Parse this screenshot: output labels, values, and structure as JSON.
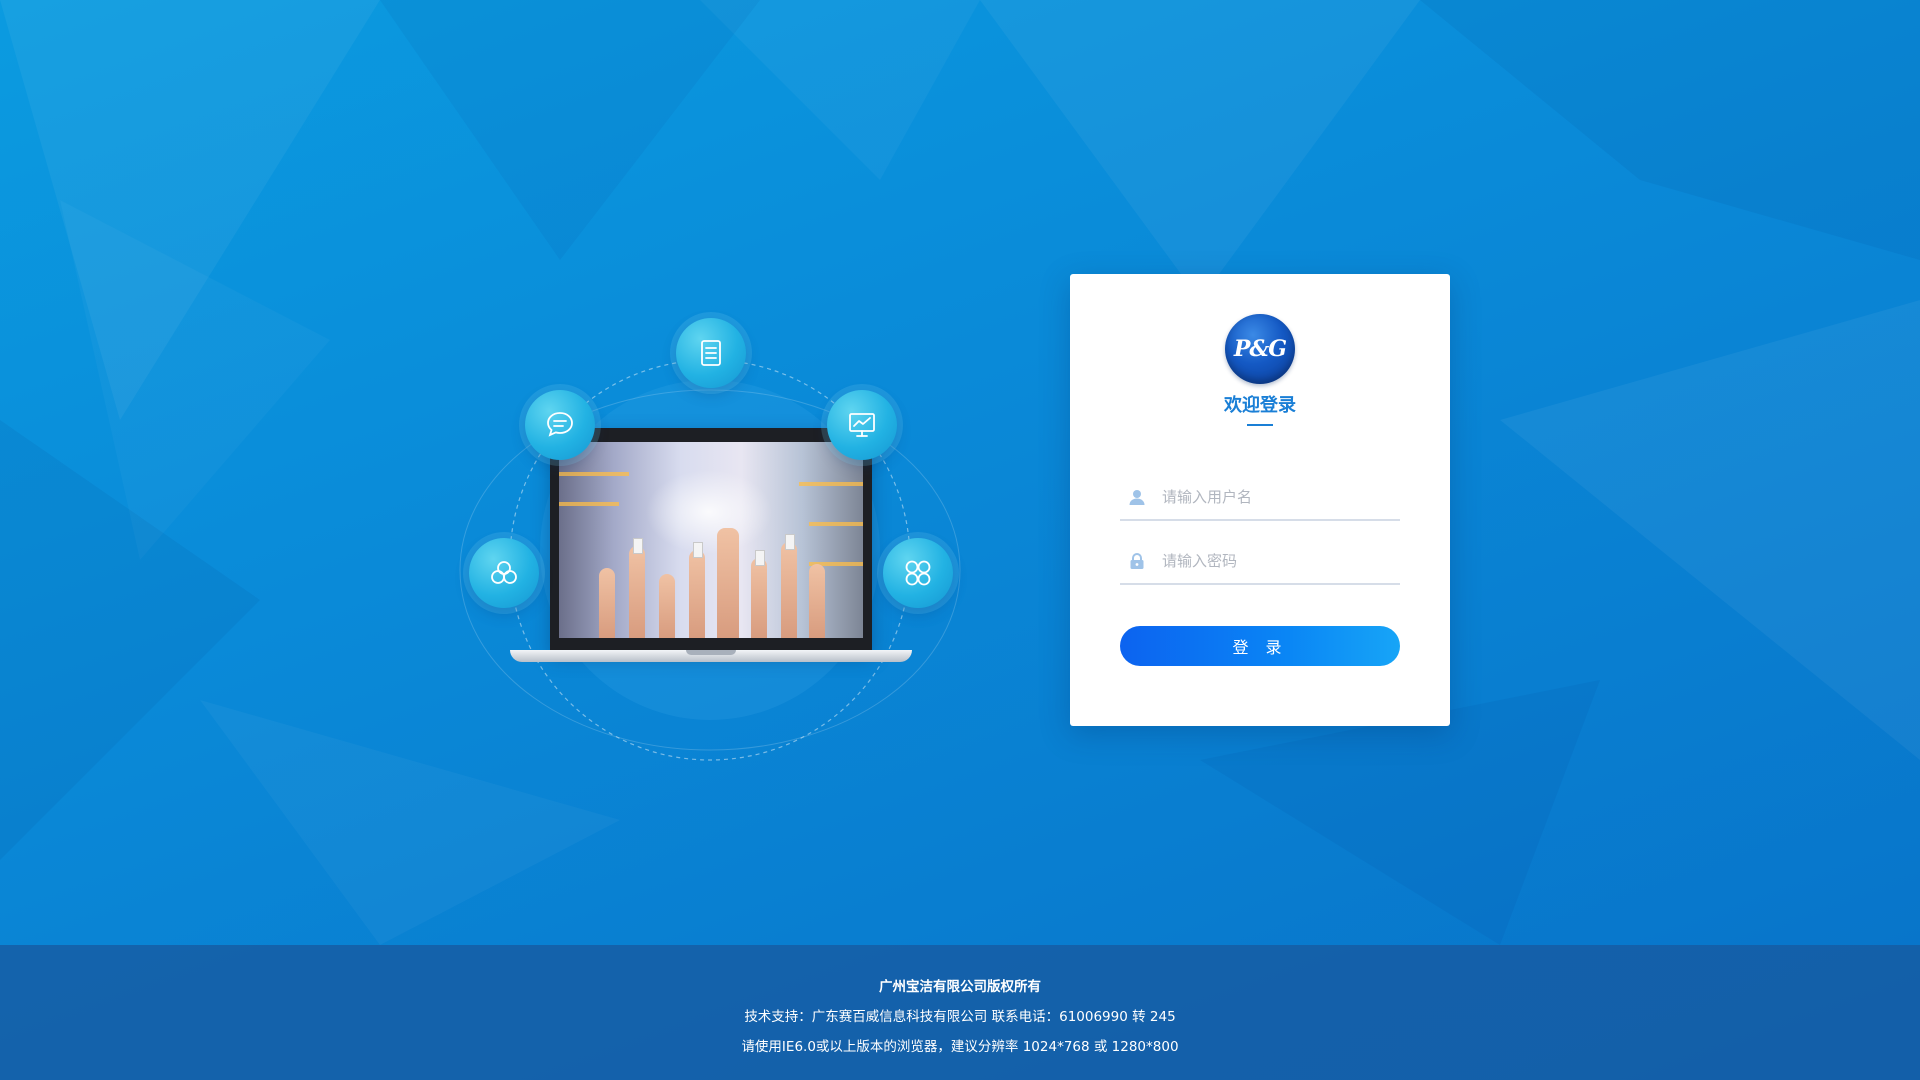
{
  "login": {
    "logo_text": "P&G",
    "title": "欢迎登录",
    "username_placeholder": "请输入用户名",
    "password_placeholder": "请输入密码",
    "submit_label": "登 录"
  },
  "footer": {
    "copyright": "广州宝洁有限公司版权所有",
    "support": "技术支持：广东赛百威信息科技有限公司 联系电话：61006990 转 245",
    "browser_note": "请使用IE6.0或以上版本的浏览器，建议分辨率 1024*768 或 1280*800"
  },
  "illustration": {
    "icons": [
      "document-icon",
      "chat-icon",
      "monitor-chart-icon",
      "circles-icon",
      "grid-icon"
    ]
  },
  "colors": {
    "accent": "#1a7fd6",
    "button_start": "#0c63f0",
    "button_end": "#17a5f7",
    "background": "#0a8ad8"
  }
}
